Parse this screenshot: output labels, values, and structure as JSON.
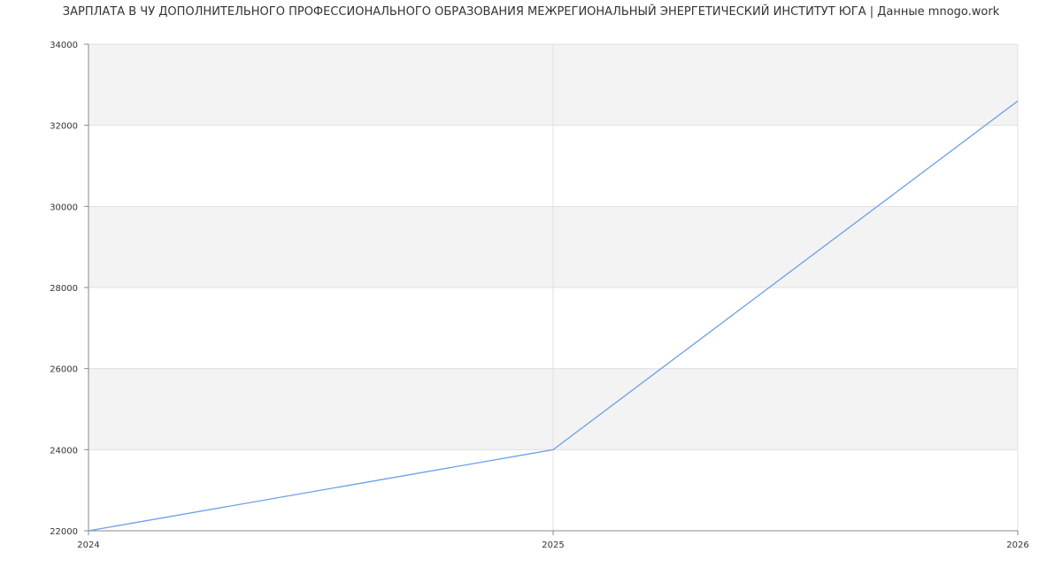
{
  "chart_data": {
    "type": "line",
    "title": "ЗАРПЛАТА В ЧУ ДОПОЛНИТЕЛЬНОГО ПРОФЕССИОНАЛЬНОГО ОБРАЗОВАНИЯ МЕЖРЕГИОНАЛЬНЫЙ ЭНЕРГЕТИЧЕСКИЙ ИНСТИТУТ ЮГА | Данные mnogo.work",
    "xlabel": "",
    "ylabel": "",
    "x": [
      2024,
      2025,
      2026
    ],
    "x_ticks": [
      "2024",
      "2025",
      "2026"
    ],
    "series": [
      {
        "values": [
          22000,
          24000,
          32600
        ]
      }
    ],
    "y_ticks": [
      "22000",
      "24000",
      "26000",
      "28000",
      "30000",
      "32000",
      "34000"
    ],
    "xlim": [
      2024,
      2026
    ],
    "ylim": [
      22000,
      34000
    ],
    "grid": true,
    "alternating_bands": true,
    "colors": {
      "line": "#6d9eeb",
      "band": "#f3f3f3",
      "grid": "#e0e0e0",
      "axis": "#888888"
    }
  }
}
